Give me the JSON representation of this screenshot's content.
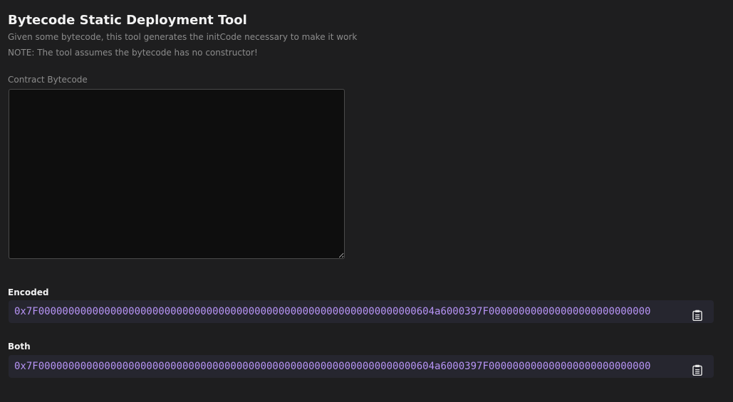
{
  "header": {
    "title": "Bytecode Static Deployment Tool",
    "description": "Given some bytecode, this tool generates the initCode necessary to make it work",
    "note": "NOTE: The tool assumes the bytecode has no constructor!"
  },
  "bytecode": {
    "label": "Contract Bytecode",
    "value": ""
  },
  "outputs": {
    "encoded": {
      "label": "Encoded",
      "value": "0x7F000000000000000000000000000000000000000000000000000000000000000604a6000397F000000000000000000000000000"
    },
    "both": {
      "label": "Both",
      "value": "0x7F000000000000000000000000000000000000000000000000000000000000000604a6000397F000000000000000000000000000"
    }
  },
  "icons": {
    "copy": "clipboard-icon"
  },
  "colors": {
    "background": "#1e1e1f",
    "code_text": "#b794f6",
    "code_background": "#26262f"
  }
}
